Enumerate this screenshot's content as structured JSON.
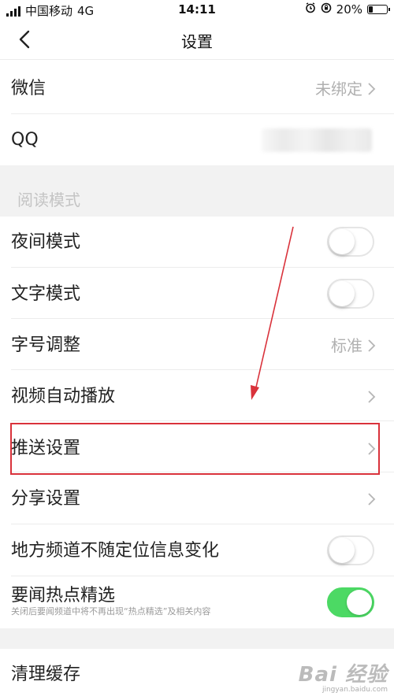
{
  "status_bar": {
    "carrier": "中国移动",
    "network": "4G",
    "time": "14:11",
    "battery": "20%",
    "battery_level": 0.2
  },
  "nav": {
    "title": "设置",
    "back_icon": "chevron-left-icon"
  },
  "account": {
    "wechat_label": "微信",
    "wechat_value": "未绑定",
    "qq_label": "QQ"
  },
  "reading_section": {
    "title": "阅读模式"
  },
  "settings": {
    "night_mode": {
      "label": "夜间模式",
      "on": false
    },
    "text_mode": {
      "label": "文字模式",
      "on": false
    },
    "font_size": {
      "label": "字号调整",
      "value": "标准"
    },
    "video_autoplay": {
      "label": "视频自动播放"
    },
    "push": {
      "label": "推送设置"
    },
    "share": {
      "label": "分享设置"
    },
    "local_channel": {
      "label": "地方频道不随定位信息变化",
      "on": false
    },
    "hot_picks": {
      "label": "要闻热点精选",
      "desc": "关闭后要闻频道中将不再出现“热点精选”及相关内容",
      "on": true
    },
    "clear_cache": {
      "label": "清理缓存"
    }
  },
  "colors": {
    "toggle_on": "#4cd964",
    "highlight": "#d9323b"
  },
  "watermark": {
    "logo": "Bai 经验",
    "sub": "jingyan.baidu.com"
  }
}
